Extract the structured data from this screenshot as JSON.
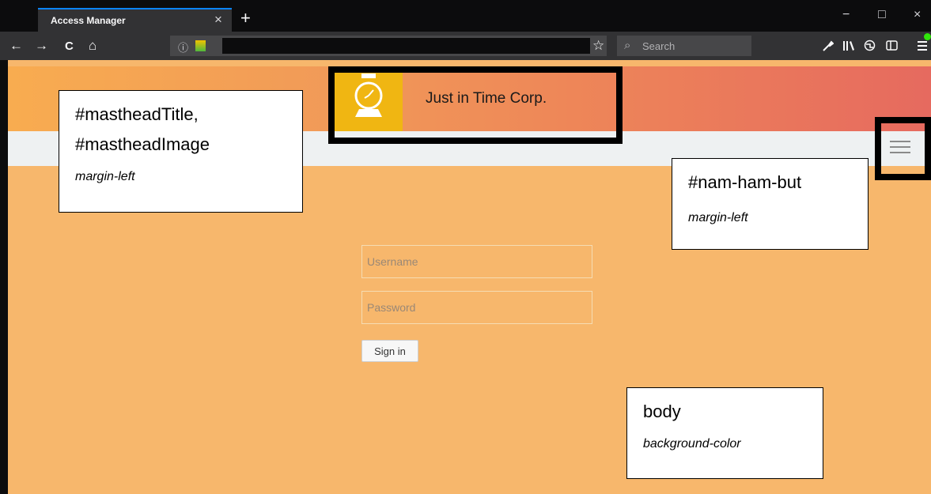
{
  "browser": {
    "tab_title": "Access Manager",
    "tab_close": "×",
    "new_tab": "+",
    "minimize": "−",
    "maximize": "□",
    "close": "×",
    "back": "←",
    "forward": "→",
    "reload": "C",
    "home": "⌂",
    "info": "ⓘ",
    "bookmark_star": "☆",
    "search_placeholder": "Search",
    "toolbar_icons": [
      "wrench-icon",
      "library-icon",
      "globe-icon",
      "sidebar-icon",
      "menu-icon"
    ]
  },
  "page": {
    "masthead_title": "Just in Time Corp.",
    "username_placeholder": "Username",
    "password_placeholder": "Password",
    "signin_label": "Sign in"
  },
  "colors": {
    "body_background": "#f7b76c",
    "masthead_gradient_start": "#f8ac50",
    "masthead_gradient_end": "#e66a5f",
    "logo_tile": "#f0b612",
    "nav_strip": "#eef1f2"
  },
  "annotations": {
    "masthead": {
      "title_line1": "#mastheadTitle,",
      "title_line2": "#mastheadImage",
      "property": "margin-left"
    },
    "hamburger": {
      "title": "#nam-ham-but",
      "property": "margin-left"
    },
    "body": {
      "title": "body",
      "property": "background-color"
    }
  }
}
